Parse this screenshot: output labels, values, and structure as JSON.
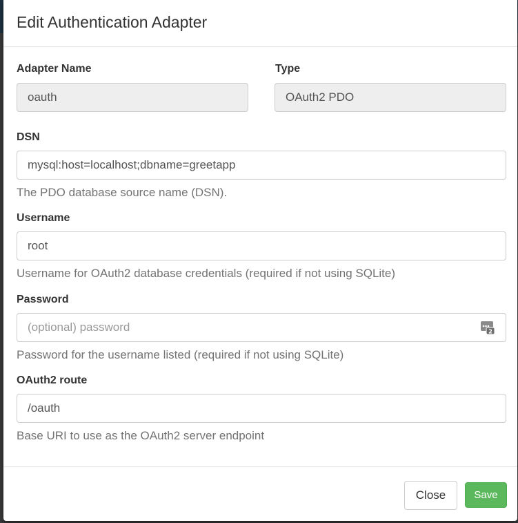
{
  "modal": {
    "title": "Edit Authentication Adapter"
  },
  "fields": {
    "adapter_name": {
      "label": "Adapter Name",
      "value": "oauth"
    },
    "type": {
      "label": "Type",
      "value": "OAuth2 PDO"
    },
    "dsn": {
      "label": "DSN",
      "value": "mysql:host=localhost;dbname=greetapp",
      "help": "The PDO database source name (DSN)."
    },
    "username": {
      "label": "Username",
      "value": "root",
      "help": "Username for OAuth2 database credentials (required if not using SQLite)"
    },
    "password": {
      "label": "Password",
      "value": "",
      "placeholder": "(optional) password",
      "help": "Password for the username listed (required if not using SQLite)"
    },
    "oauth2_route": {
      "label": "OAuth2 route",
      "value": "/oauth",
      "help": "Base URI to use as the OAuth2 server endpoint"
    }
  },
  "footer": {
    "close_label": "Close",
    "save_label": "Save"
  },
  "colors": {
    "save_button": "#5cb85c",
    "readonly_bg": "#eeeeee",
    "help_text": "#737373"
  },
  "icons": {
    "password_manager": "password-manager-icon"
  }
}
